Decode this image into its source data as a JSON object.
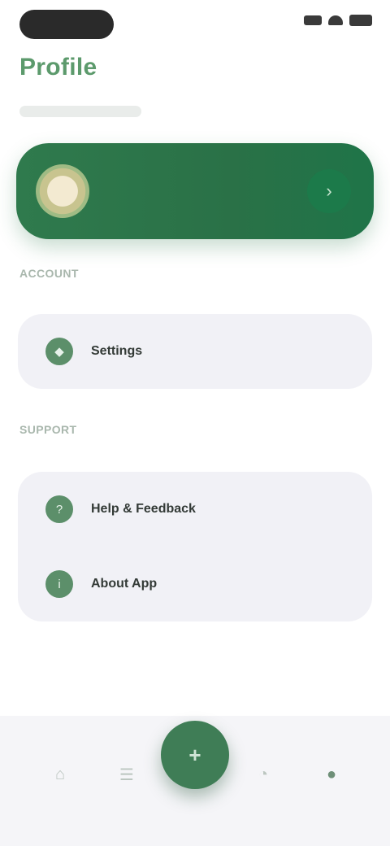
{
  "status_bar": {},
  "header": {
    "title": "Profile"
  },
  "profile": {
    "name": "",
    "subtitle": "",
    "chevron": "›"
  },
  "sections": [
    {
      "label": "ACCOUNT"
    },
    {
      "label": "SUPPORT"
    }
  ],
  "account_items": [
    {
      "icon": "shield-icon",
      "label": "Settings"
    }
  ],
  "support_items": [
    {
      "icon": "help-icon",
      "label": "Help & Feedback"
    },
    {
      "icon": "info-icon",
      "label": "About App"
    }
  ],
  "bottom_nav": {
    "fab": "+",
    "items": [
      "⌂",
      "☰",
      "◔",
      "●"
    ]
  },
  "colors": {
    "accent": "#2f7a4d",
    "title": "#5c9a6c",
    "card_bg": "#f1f1f6"
  }
}
